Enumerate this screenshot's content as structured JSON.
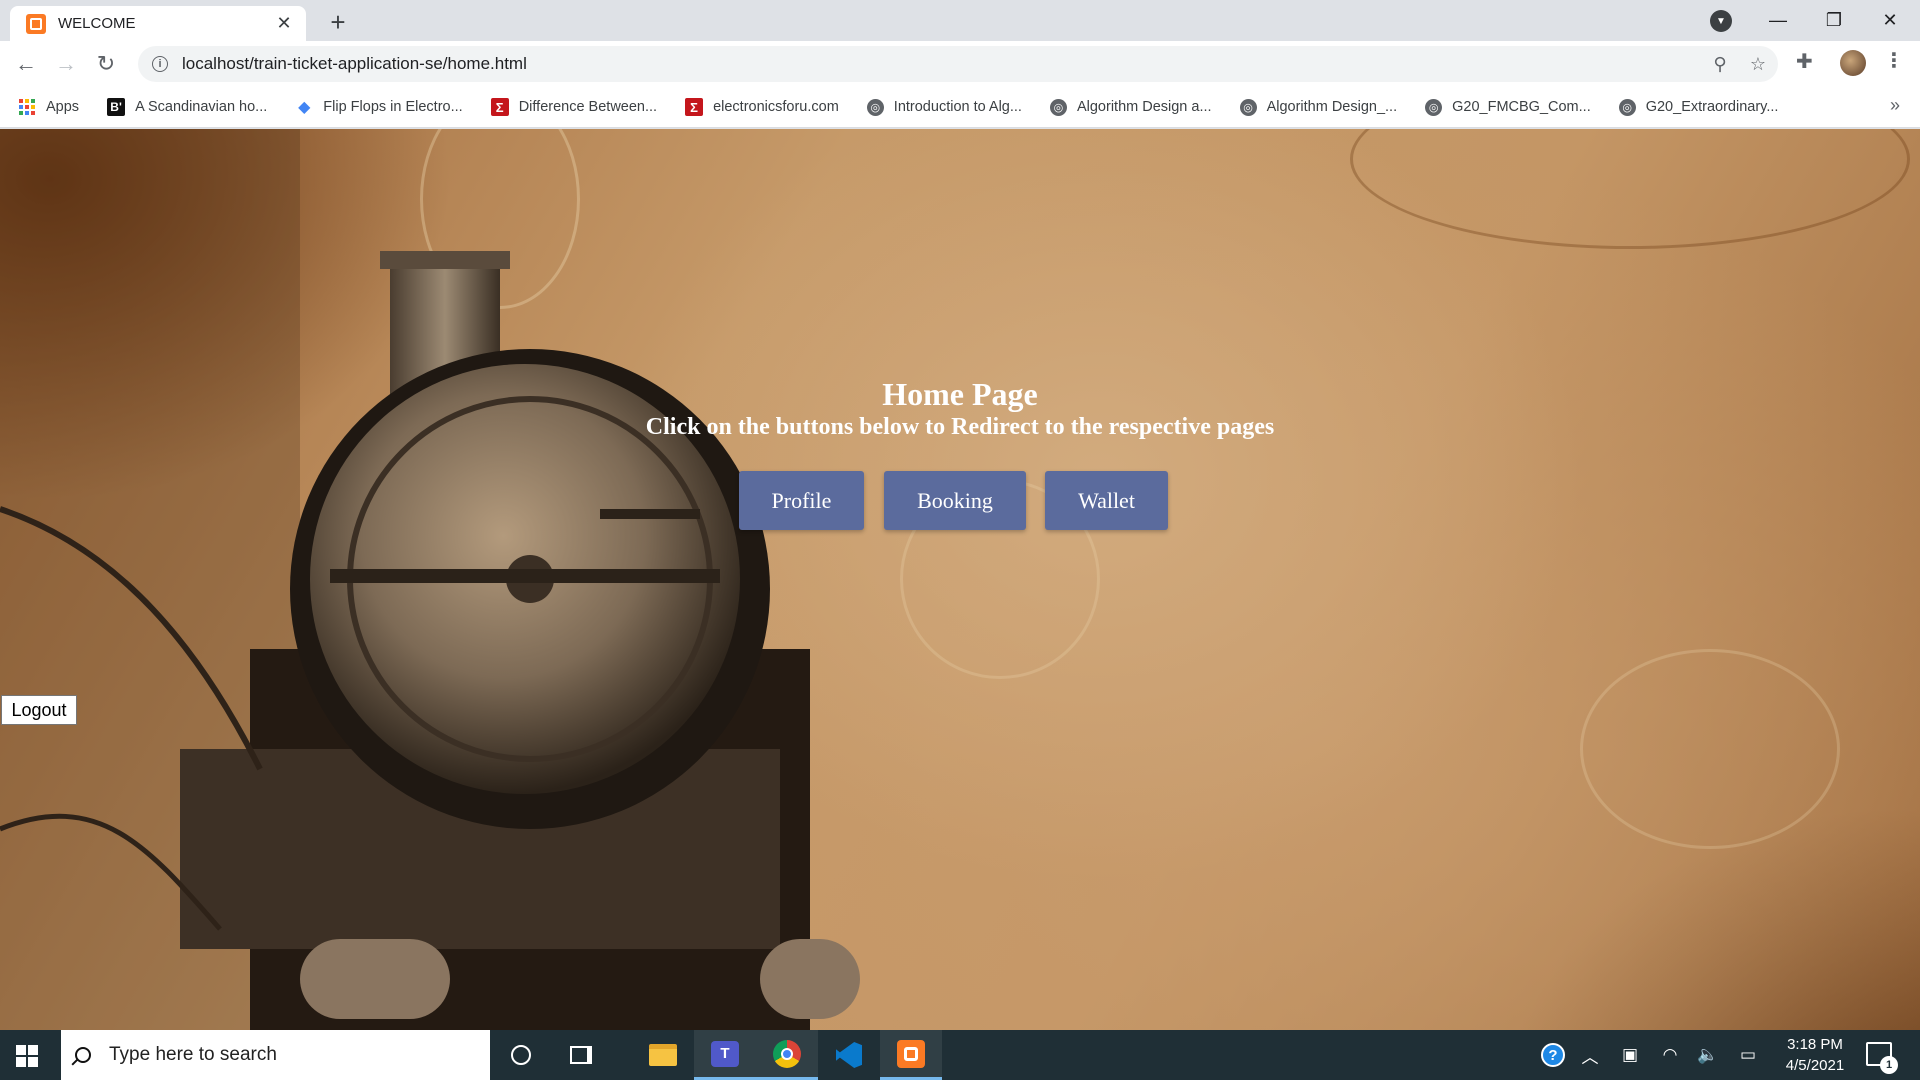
{
  "browser": {
    "tab": {
      "title": "WELCOME",
      "close_glyph": "✕"
    },
    "new_tab_glyph": "+",
    "window_controls": {
      "minimize": "—",
      "maximize": "❐",
      "close": "✕"
    },
    "profile_dropdown_glyph": "▼",
    "toolbar": {
      "back": "←",
      "forward": "→",
      "reload": "↻",
      "info_glyph": "i"
    },
    "url": "localhost/train-ticket-application-se/home.html",
    "omnibox_icons": {
      "zoom": "⚲",
      "star": "☆"
    },
    "extensions_glyph": "✚",
    "menu_glyph": "⋮",
    "bookmarks": [
      {
        "label": "Apps",
        "icon": "apps-grid-icon"
      },
      {
        "label": "A Scandinavian ho...",
        "icon": "b-icon",
        "glyph": "B'"
      },
      {
        "label": "Flip Flops in Electro...",
        "icon": "diamond-icon",
        "glyph": "◆"
      },
      {
        "label": "Difference Between...",
        "icon": "sigma-icon",
        "glyph": "Σ"
      },
      {
        "label": "electronicsforu.com",
        "icon": "sigma-icon",
        "glyph": "Σ"
      },
      {
        "label": "Introduction to Alg...",
        "icon": "globe-icon",
        "glyph": "◎"
      },
      {
        "label": "Algorithm Design a...",
        "icon": "globe-icon",
        "glyph": "◎"
      },
      {
        "label": "Algorithm Design_...",
        "icon": "globe-icon",
        "glyph": "◎"
      },
      {
        "label": "G20_FMCBG_Com...",
        "icon": "globe-icon",
        "glyph": "◎"
      },
      {
        "label": "G20_Extraordinary...",
        "icon": "globe-icon",
        "glyph": "◎"
      }
    ],
    "bookmarks_more_glyph": "»"
  },
  "page": {
    "title": "Home Page",
    "subtitle": "Click on the buttons below to Redirect to the respective pages",
    "buttons": {
      "profile": "Profile",
      "booking": "Booking",
      "wallet": "Wallet"
    },
    "logout": "Logout",
    "button_color": "#5b6b9d"
  },
  "taskbar": {
    "search_placeholder": "Type here to search",
    "tray": {
      "help": "?",
      "chevron": "︿",
      "meet": "▣",
      "wifi": "◠",
      "volume": "🔈",
      "battery": "▭"
    },
    "time": "3:18 PM",
    "date": "4/5/2021",
    "notification_count": "1"
  }
}
